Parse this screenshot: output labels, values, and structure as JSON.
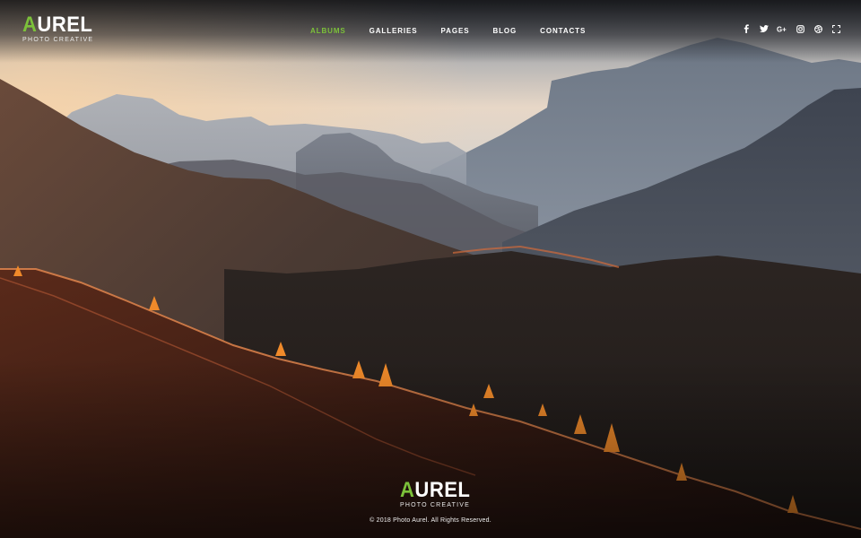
{
  "brand": {
    "accent_letter": "A",
    "rest_letters": "UREL",
    "tagline": "PHOTO CREATIVE",
    "accent_color": "#7cc13a"
  },
  "nav": {
    "items": [
      {
        "label": "ALBUMS",
        "active": true
      },
      {
        "label": "GALLERIES",
        "active": false
      },
      {
        "label": "PAGES",
        "active": false
      },
      {
        "label": "BLOG",
        "active": false
      },
      {
        "label": "CONTACTS",
        "active": false
      }
    ]
  },
  "social": {
    "icons": [
      "facebook-icon",
      "twitter-icon",
      "google-plus-icon",
      "instagram-icon",
      "dribbble-icon",
      "fullscreen-icon"
    ]
  },
  "hero": {
    "image": "mountain-landscape-sunset",
    "description_hidden": true
  },
  "footer": {
    "copyright": "© 2018 Photo Aurel. All Rights Reserved."
  }
}
